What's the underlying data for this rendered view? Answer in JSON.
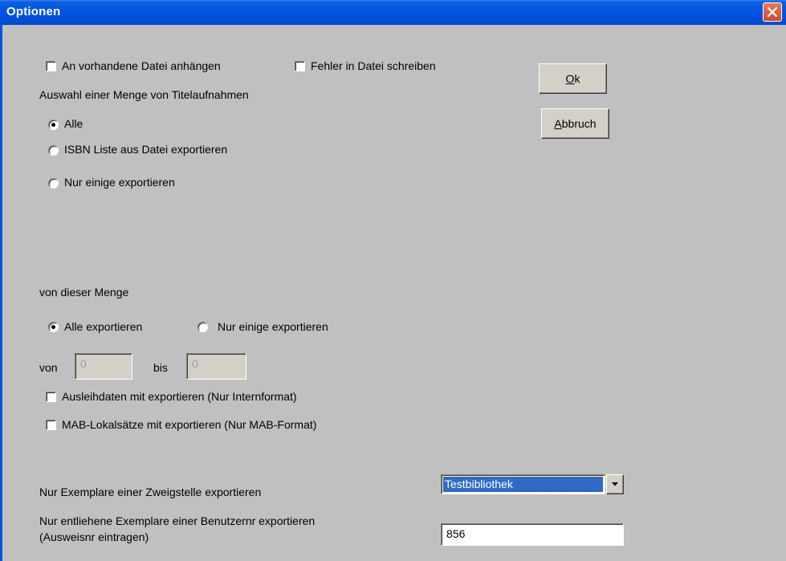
{
  "window": {
    "title": "Optionen",
    "close_icon": "close-icon"
  },
  "options": {
    "append_label": "An vorhandene Datei anhängen",
    "append_checked": false,
    "errors_label": "Fehler in Datei schreiben",
    "errors_checked": false
  },
  "selection": {
    "heading": "Auswahl einer Menge von Titelaufnahmen",
    "alle_label": "Alle",
    "isbn_label": "ISBN Liste aus Datei exportieren",
    "some_label": "Nur einige exportieren",
    "selected": "alle"
  },
  "buttons": {
    "ok_label": "Ok",
    "ok_mnemonic": "O",
    "cancel_label": "Abbruch",
    "cancel_mnemonic": "A"
  },
  "subset": {
    "heading": "von dieser Menge",
    "all_export_label": "Alle exportieren",
    "some_export_label": "Nur einige exportieren",
    "selected": "all",
    "from_label": "von",
    "from_value": "0",
    "to_label": "bis",
    "to_value": "0"
  },
  "extras": {
    "loan_label": "Ausleihdaten mit exportieren (Nur Internformat)",
    "loan_checked": false,
    "mab_label": "MAB-Lokalsätze mit exportieren (Nur MAB-Format)",
    "mab_checked": false
  },
  "branch": {
    "label": "Nur Exemplare einer Zweigstelle exportieren",
    "selected": "Testbibliothek",
    "dropdown_icon": "chevron-down-icon"
  },
  "borrower": {
    "label_line1": "Nur entliehene Exemplare einer Benutzernr exportieren",
    "label_line2": "(Ausweisnr eintragen)",
    "value": "856"
  },
  "colors": {
    "titlebar": "#0054e3",
    "dialog_bg": "#c0c0c0",
    "selection": "#316ac5"
  }
}
